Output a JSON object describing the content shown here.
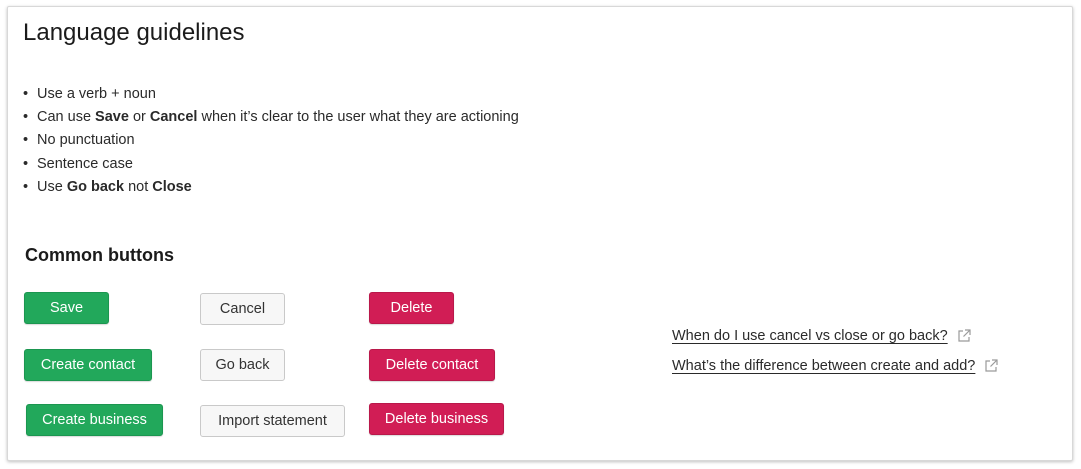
{
  "title": "Language guidelines",
  "guidelines": [
    [
      {
        "t": "Use a verb + noun",
        "b": false
      }
    ],
    [
      {
        "t": "Can use ",
        "b": false
      },
      {
        "t": "Save",
        "b": true
      },
      {
        "t": " or ",
        "b": false
      },
      {
        "t": "Cancel",
        "b": true
      },
      {
        "t": " when it’s clear to the user what they are actioning",
        "b": false
      }
    ],
    [
      {
        "t": "No punctuation",
        "b": false
      }
    ],
    [
      {
        "t": "Sentence case",
        "b": false
      }
    ],
    [
      {
        "t": "Use ",
        "b": false
      },
      {
        "t": "Go back",
        "b": true
      },
      {
        "t": " not ",
        "b": false
      },
      {
        "t": "Close",
        "b": true
      }
    ]
  ],
  "bullet": "•",
  "common_buttons": {
    "heading": "Common buttons",
    "save": "Save",
    "cancel": "Cancel",
    "delete": "Delete",
    "create_contact": "Create contact",
    "go_back": "Go back",
    "delete_contact": "Delete contact",
    "create_business": "Create business",
    "import_statement": "Import statement",
    "delete_business": "Delete business"
  },
  "links": {
    "cancel_vs_close": "When do I use cancel vs close or go back?",
    "create_vs_add": "What’s the difference between create and add?",
    "icon": "external-link-icon"
  },
  "colors": {
    "primary_green": "#22a85b",
    "danger_red": "#d11d55",
    "secondary_bg": "#f7f7f7"
  }
}
